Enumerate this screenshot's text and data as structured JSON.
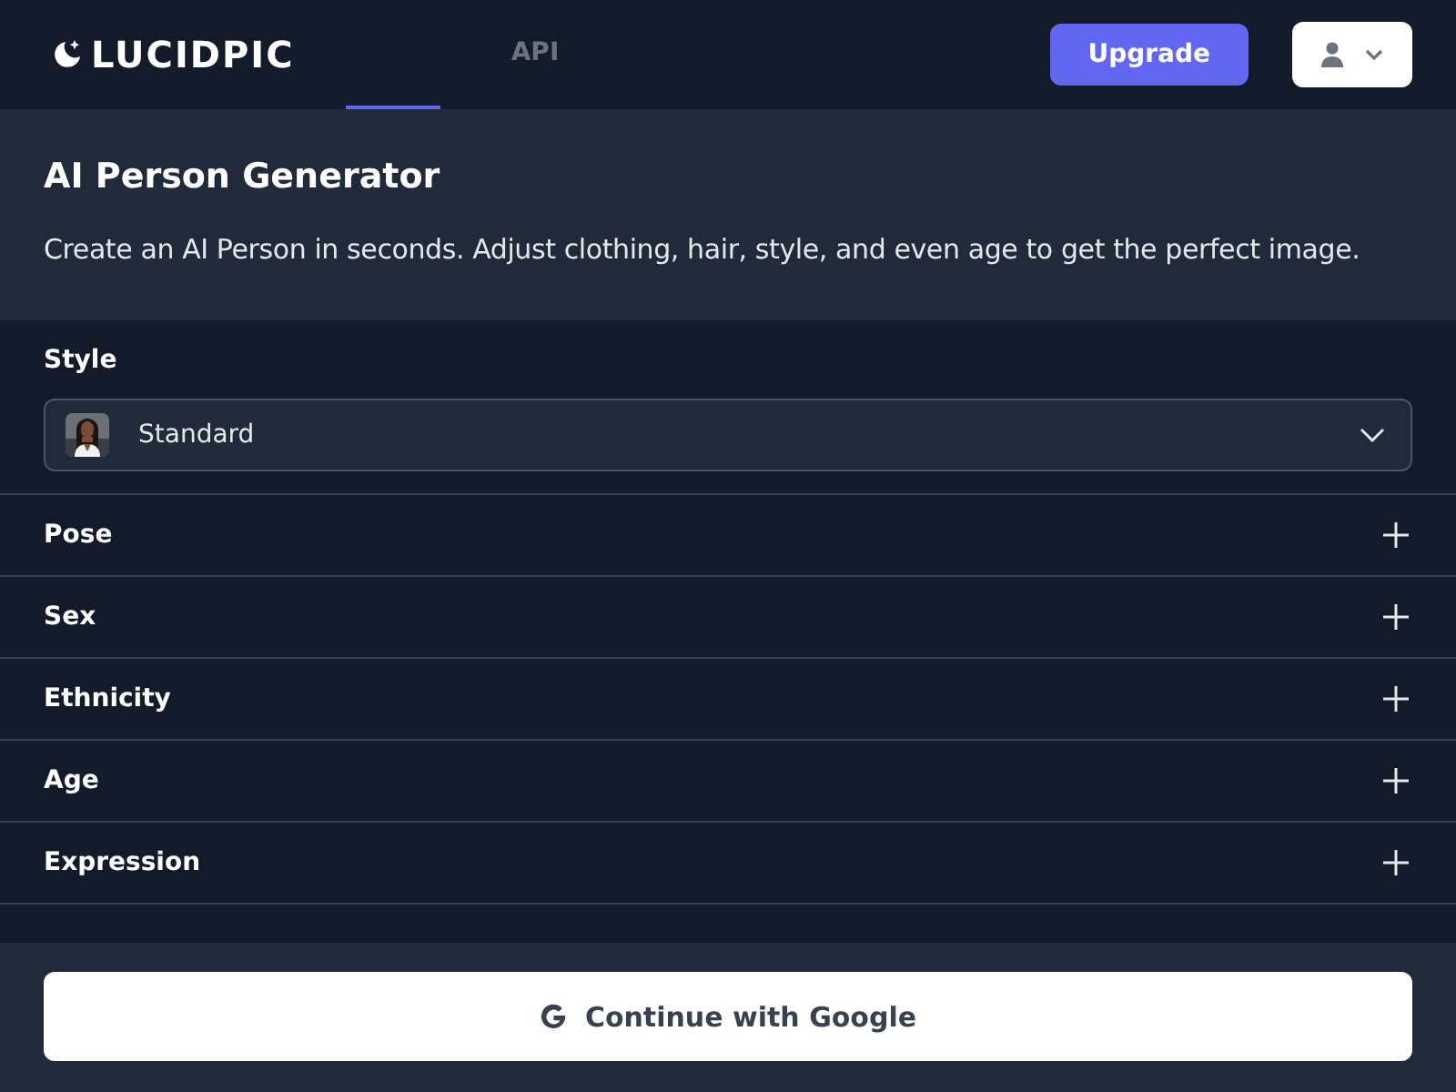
{
  "header": {
    "logo": "LUCIDPIC",
    "tabs": [
      {
        "selected": true
      },
      {
        "label": "API",
        "selected": false
      }
    ],
    "upgrade": "Upgrade"
  },
  "hero": {
    "title": "AI Person Generator",
    "description": "Create an AI Person in seconds. Adjust clothing, hair, style, and even age to get the perfect image."
  },
  "style": {
    "label": "Style",
    "value": "Standard"
  },
  "options": [
    {
      "label": "Pose",
      "expanded": false
    },
    {
      "label": "Sex",
      "expanded": false
    },
    {
      "label": "Ethnicity",
      "expanded": false
    },
    {
      "label": "Age",
      "expanded": false
    },
    {
      "label": "Expression",
      "expanded": false
    }
  ],
  "footer": {
    "button": "Continue with Google"
  }
}
